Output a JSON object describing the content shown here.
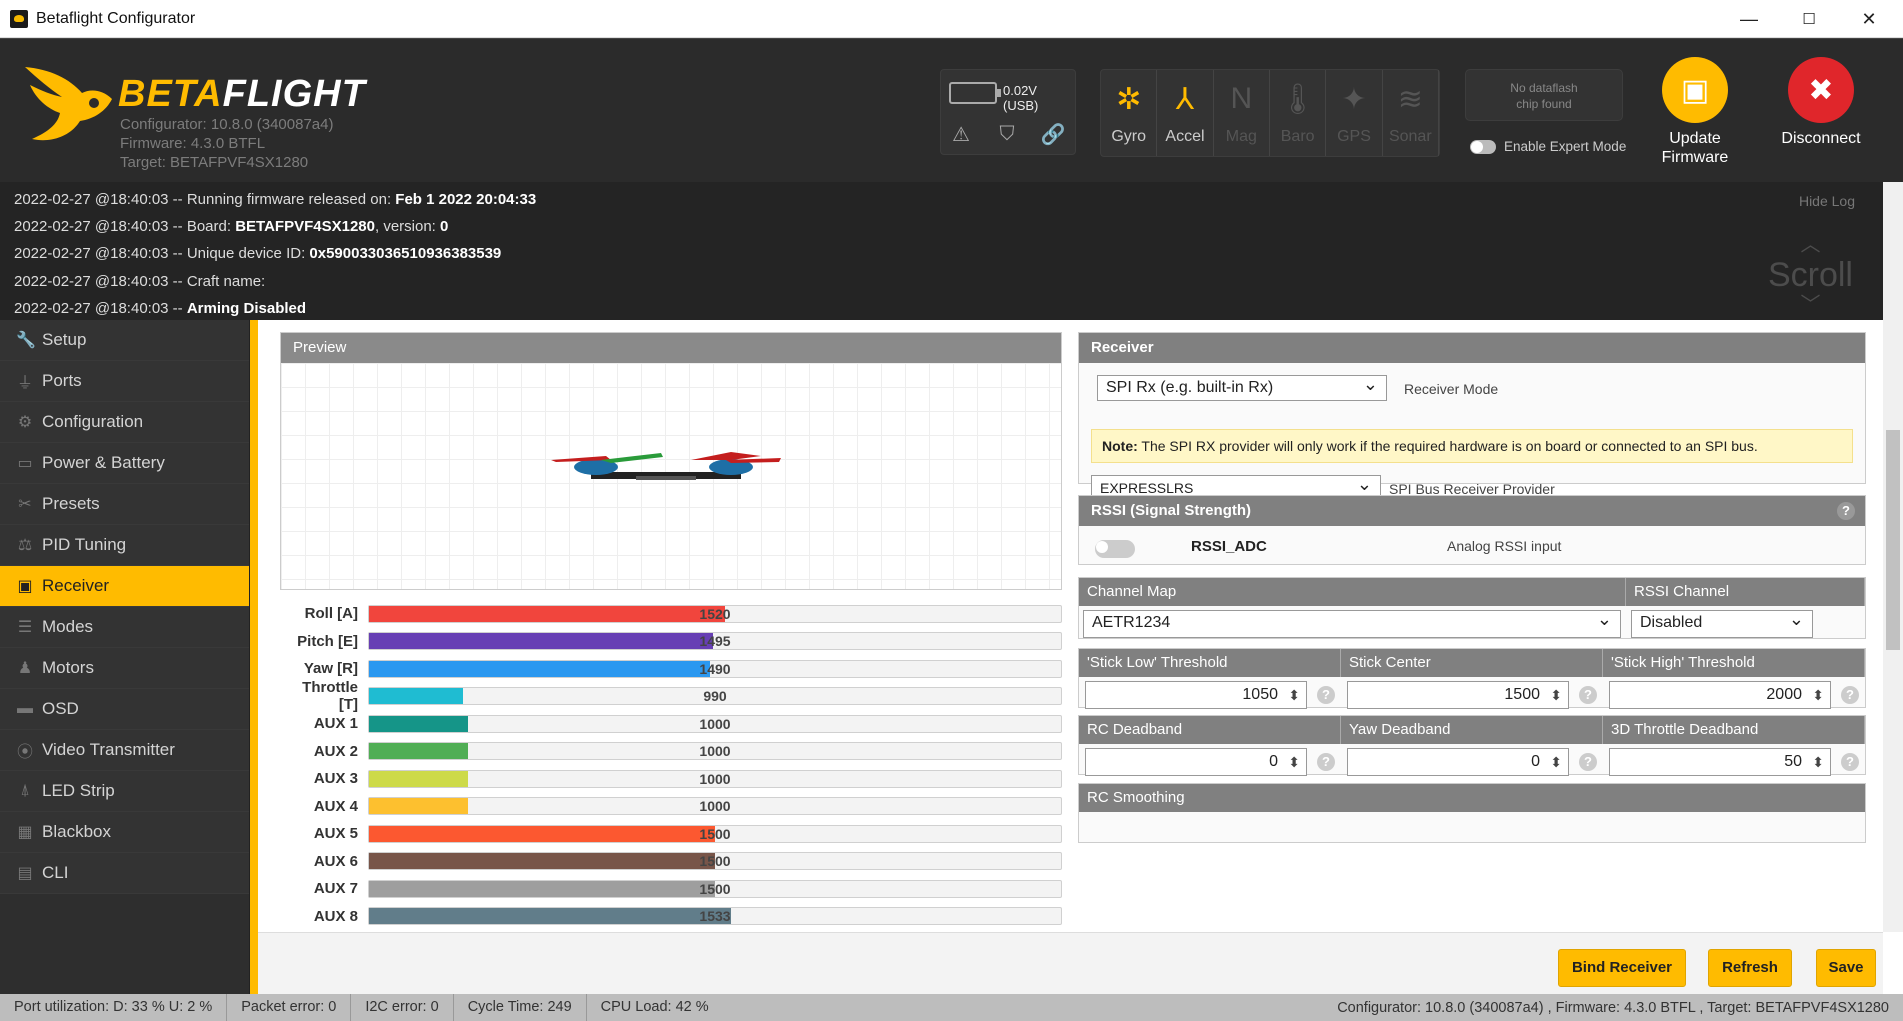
{
  "window": {
    "title": "Betaflight Configurator",
    "min": "—",
    "max": "☐",
    "close": "✕"
  },
  "header": {
    "brand_a": "BETA",
    "brand_b": "FLIGHT",
    "configurator": "Configurator: 10.8.0 (340087a4)",
    "firmware": "Firmware: 4.3.0 BTFL",
    "target": "Target: BETAFPVF4SX1280",
    "voltage": "0.02V (USB)",
    "sensors": [
      {
        "label": "Gyro",
        "icon": "gyro-icon",
        "glyph": "✲",
        "on": true
      },
      {
        "label": "Accel",
        "icon": "accel-icon",
        "glyph": "⅄",
        "on": true
      },
      {
        "label": "Mag",
        "icon": "mag-icon",
        "glyph": "N",
        "on": false
      },
      {
        "label": "Baro",
        "icon": "baro-icon",
        "glyph": "🌡",
        "on": false
      },
      {
        "label": "GPS",
        "icon": "gps-icon",
        "glyph": "✦",
        "on": false
      },
      {
        "label": "Sonar",
        "icon": "sonar-icon",
        "glyph": "≋",
        "on": false
      }
    ],
    "dataflash_l1": "No dataflash",
    "dataflash_l2": "chip found",
    "expert_mode": "Enable Expert Mode",
    "update_l1": "Update",
    "update_l2": "Firmware",
    "disconnect": "Disconnect"
  },
  "log": {
    "hide": "Hide Log",
    "scroll": "Scroll",
    "lines": [
      {
        "prefix": "2022-02-27 @18:40:03 -- Running firmware released on: ",
        "bold": "Feb 1 2022 20:04:33",
        "suffix": ""
      },
      {
        "prefix": "2022-02-27 @18:40:03 -- Board: ",
        "bold": "BETAFPVF4SX1280",
        "suffix": ", version: ",
        "bold2": "0"
      },
      {
        "prefix": "2022-02-27 @18:40:03 -- Unique device ID: ",
        "bold": "0x59003303651093638353\u00039",
        "suffix": ""
      },
      {
        "prefix": "2022-02-27 @18:40:03 -- Craft name: ",
        "bold": "",
        "suffix": ""
      },
      {
        "prefix": "2022-02-27 @18:40:03 -- ",
        "bold": "Arming Disabled",
        "suffix": ""
      }
    ]
  },
  "sidebar": [
    {
      "label": "Setup",
      "icon": "wrench-icon",
      "glyph": "🔧"
    },
    {
      "label": "Ports",
      "icon": "plug-icon",
      "glyph": "⏚"
    },
    {
      "label": "Configuration",
      "icon": "gear-icon",
      "glyph": "⚙"
    },
    {
      "label": "Power & Battery",
      "icon": "battery-icon",
      "glyph": "▭"
    },
    {
      "label": "Presets",
      "icon": "presets-icon",
      "glyph": "✂"
    },
    {
      "label": "PID Tuning",
      "icon": "pid-icon",
      "glyph": "⚖"
    },
    {
      "label": "Receiver",
      "icon": "receiver-icon",
      "glyph": "▣",
      "active": true
    },
    {
      "label": "Modes",
      "icon": "modes-icon",
      "glyph": "☰"
    },
    {
      "label": "Motors",
      "icon": "motor-icon",
      "glyph": "♟"
    },
    {
      "label": "OSD",
      "icon": "osd-icon",
      "glyph": "▬"
    },
    {
      "label": "Video Transmitter",
      "icon": "vtx-icon",
      "glyph": "⦿"
    },
    {
      "label": "LED Strip",
      "icon": "led-icon",
      "glyph": "⍋"
    },
    {
      "label": "Blackbox",
      "icon": "blackbox-icon",
      "glyph": "▦"
    },
    {
      "label": "CLI",
      "icon": "cli-icon",
      "glyph": "▤"
    }
  ],
  "preview": {
    "title": "Preview"
  },
  "channels": [
    {
      "label": "Roll [A]",
      "value": 1520,
      "color": "#f1453d"
    },
    {
      "label": "Pitch [E]",
      "value": 1495,
      "color": "#673fb4"
    },
    {
      "label": "Yaw [R]",
      "value": 1490,
      "color": "#2b98f0"
    },
    {
      "label": "Throttle [T]",
      "value": 990,
      "color": "#1fbcd2"
    },
    {
      "label": "AUX 1",
      "value": 1000,
      "color": "#159588"
    },
    {
      "label": "AUX 2",
      "value": 1000,
      "color": "#50ae55"
    },
    {
      "label": "AUX 3",
      "value": 1000,
      "color": "#cdda49"
    },
    {
      "label": "AUX 4",
      "value": 1000,
      "color": "#fdc02f"
    },
    {
      "label": "AUX 5",
      "value": 1500,
      "color": "#fc5830"
    },
    {
      "label": "AUX 6",
      "value": 1500,
      "color": "#785549"
    },
    {
      "label": "AUX 7",
      "value": 1500,
      "color": "#9e9e9e"
    },
    {
      "label": "AUX 8",
      "value": 1533,
      "color": "#617d8a"
    }
  ],
  "receiver": {
    "title": "Receiver",
    "mode_value": "SPI Rx (e.g. built-in Rx)",
    "mode_label": "Receiver Mode",
    "note_bold": "Note:",
    "note_text": " The SPI RX provider will only work if the required hardware is on board or connected to an SPI bus.",
    "provider_value": "EXPRESSLRS",
    "provider_label": "SPI Bus Receiver Provider"
  },
  "rssi": {
    "title": "RSSI (Signal Strength)",
    "name": "RSSI_ADC",
    "desc": "Analog RSSI input",
    "help": "?"
  },
  "channelmap": {
    "hdr_map": "Channel Map",
    "hdr_rssi": "RSSI Channel",
    "map_value": "AETR1234",
    "rssi_value": "Disabled"
  },
  "thresholds": {
    "hdr_low": "'Stick Low' Threshold",
    "hdr_center": "Stick Center",
    "hdr_high": "'Stick High' Threshold",
    "low": "1050",
    "center": "1500",
    "high": "2000"
  },
  "deadband": {
    "hdr_rc": "RC Deadband",
    "hdr_yaw": "Yaw Deadband",
    "hdr_thr": "3D Throttle Deadband",
    "rc": "0",
    "yaw": "0",
    "thr": "50"
  },
  "smoothing": {
    "title": "RC Smoothing"
  },
  "buttons": {
    "bind": "Bind Receiver",
    "refresh": "Refresh",
    "save": "Save"
  },
  "status": {
    "port": "Port utilization: D: 33 % U: 2 %",
    "packet": "Packet error: 0",
    "i2c": "I2C error: 0",
    "cycle": "Cycle Time: 249",
    "cpu": "CPU Load: 42 %",
    "right": "Configurator: 10.8.0 (340087a4) , Firmware: 4.3.0 BTFL , Target: BETAFPVF4SX1280"
  }
}
